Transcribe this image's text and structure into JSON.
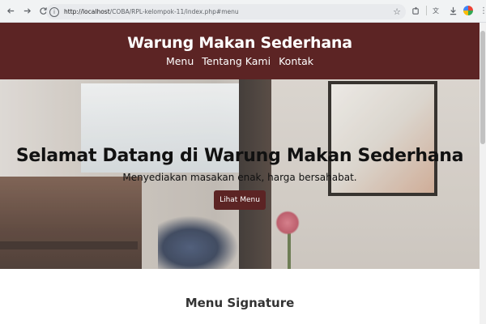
{
  "browser": {
    "url_host": "http://localhost",
    "url_path": "/COBA/RPL-kelompok-11/index.php#menu",
    "icons": [
      "back-icon",
      "forward-icon",
      "reload-icon",
      "site-info-icon",
      "bookmark-star-icon",
      "extensions-icon",
      "translate-icon",
      "download-icon",
      "profile-icon",
      "menu-icon"
    ]
  },
  "header": {
    "title": "Warung Makan Sederhana",
    "nav": [
      "Menu",
      "Tentang Kami",
      "Kontak"
    ]
  },
  "hero": {
    "title": "Selamat Datang di Warung Makan Sederhana",
    "subtitle": "Menyediakan masakan enak, harga bersahabat.",
    "button_label": "Lihat Menu"
  },
  "menu_section": {
    "heading": "Menu Signature"
  },
  "colors": {
    "brand": "#5c2424",
    "chrome_bg": "#f1f3f4"
  }
}
